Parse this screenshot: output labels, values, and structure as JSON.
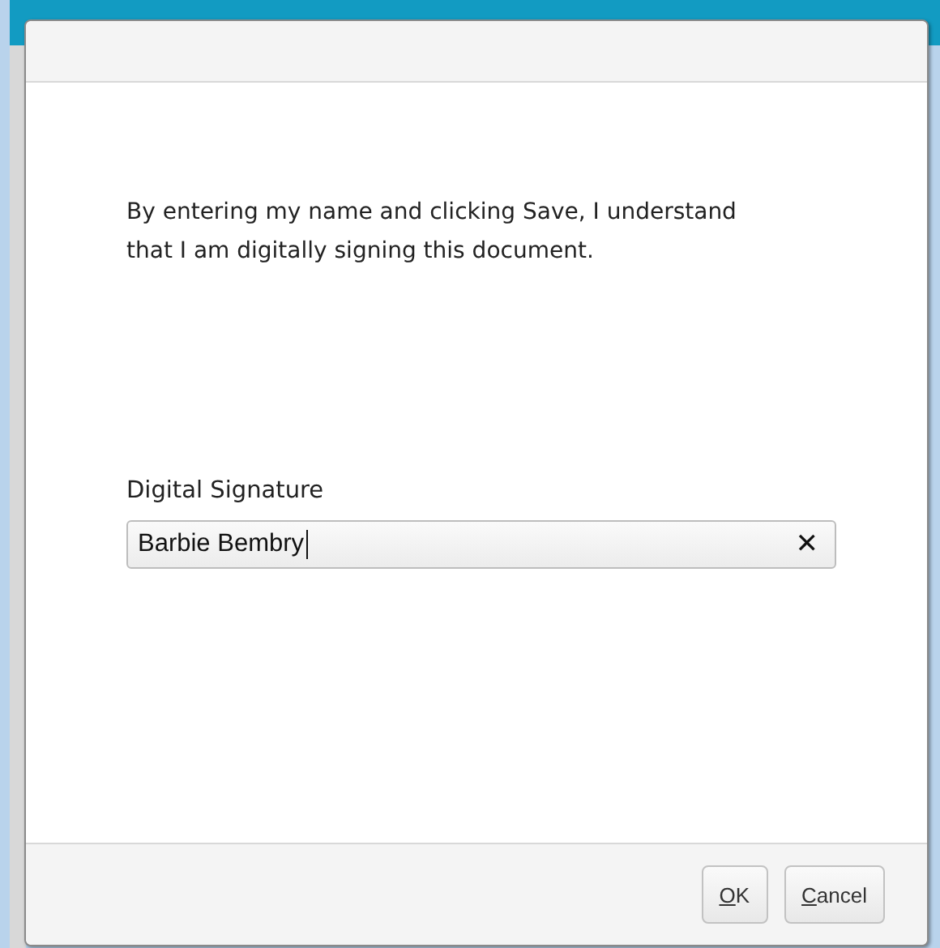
{
  "dialog": {
    "message": "By entering my name and clicking Save, I understand that I am digitally signing this document.",
    "field": {
      "label": "Digital Signature",
      "value": "Barbie Bembry",
      "clear_icon": "✕"
    },
    "buttons": [
      "OK",
      "Cancel"
    ]
  }
}
